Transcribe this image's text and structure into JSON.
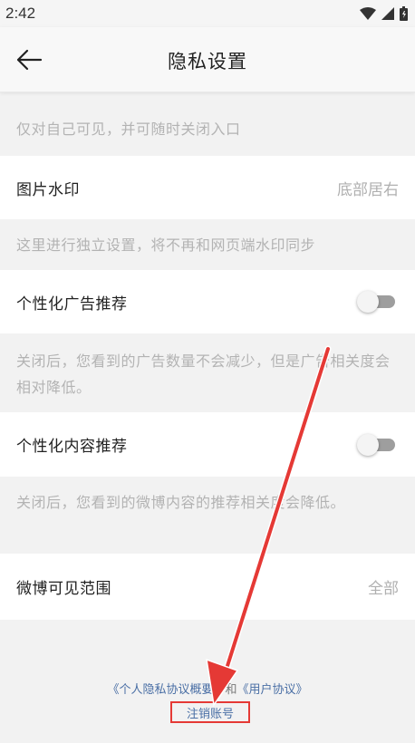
{
  "status_bar": {
    "time": "2:42",
    "icons": [
      "wifi-icon",
      "signal-icon",
      "battery-icon"
    ]
  },
  "header": {
    "back_icon": "arrow-left-icon",
    "title": "隐私设置"
  },
  "settings": {
    "note_visible_only_self": "仅对自己可见，并可随时关闭入口",
    "watermark": {
      "label": "图片水印",
      "value": "底部居右"
    },
    "note_watermark": "这里进行独立设置，将不再和网页端水印同步",
    "personalized_ads": {
      "label": "个性化广告推荐",
      "enabled": false
    },
    "note_ads": "关闭后，您看到的广告数量不会减少，但是广告相关度会相对降低。",
    "personalized_content": {
      "label": "个性化内容推荐",
      "enabled": false
    },
    "note_content": "关闭后，您看到的微博内容的推荐相关度会降低。",
    "weibo_visibility": {
      "label": "微博可见范围",
      "value": "全部"
    }
  },
  "footer": {
    "privacy_summary_link": "《个人隐私协议概要》",
    "and_text": "和",
    "user_agreement_link": "《用户协议》",
    "cancel_account_link": "注销账号"
  },
  "colors": {
    "background": "#f2f2f2",
    "row_background": "#ffffff",
    "note_text": "#b3b3b3",
    "link": "#4a6fa5",
    "annotation_red": "#e53935"
  }
}
